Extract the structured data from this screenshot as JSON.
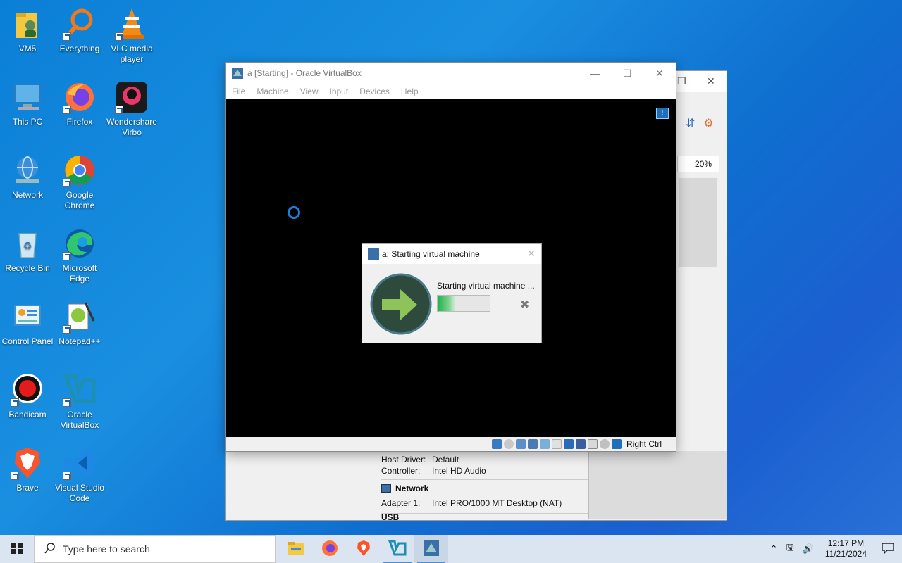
{
  "desktop": {
    "icons": [
      {
        "label": "VM5",
        "icon": "folder-user-icon"
      },
      {
        "label": "Everything",
        "icon": "everything-search-icon"
      },
      {
        "label": "VLC media player",
        "icon": "vlc-cone-icon"
      },
      {
        "label": "This PC",
        "icon": "computer-icon"
      },
      {
        "label": "Firefox",
        "icon": "firefox-icon"
      },
      {
        "label": "Wondershare Virbo",
        "icon": "virbo-icon"
      },
      {
        "label": "Network",
        "icon": "network-globe-icon"
      },
      {
        "label": "Google Chrome",
        "icon": "chrome-icon"
      },
      {
        "label": "Recycle Bin",
        "icon": "recycle-bin-icon"
      },
      {
        "label": "Microsoft Edge",
        "icon": "edge-icon"
      },
      {
        "label": "Control Panel",
        "icon": "control-panel-icon"
      },
      {
        "label": "Notepad++",
        "icon": "notepadpp-icon"
      },
      {
        "label": "Bandicam",
        "icon": "bandicam-icon"
      },
      {
        "label": "Oracle VirtualBox",
        "icon": "virtualbox-icon"
      },
      {
        "label": "Brave",
        "icon": "brave-icon"
      },
      {
        "label": "Visual Studio Code",
        "icon": "vscode-icon"
      }
    ]
  },
  "manager_window": {
    "zoom_value": "20%",
    "audio": {
      "host_driver_label": "Host Driver:",
      "host_driver_value": "Default",
      "controller_label": "Controller:",
      "controller_value": "Intel HD Audio"
    },
    "network": {
      "section_title": "Network",
      "adapter_label": "Adapter 1:",
      "adapter_value": "Intel PRO/1000 MT Desktop (NAT)"
    },
    "next_section_partial": "USB"
  },
  "vm_window": {
    "title": "a [Starting] - Oracle VirtualBox",
    "menu": [
      "File",
      "Machine",
      "View",
      "Input",
      "Devices",
      "Help"
    ],
    "host_key": "Right Ctrl"
  },
  "progress_dialog": {
    "title": "a: Starting virtual machine",
    "message": "Starting virtual machine ...",
    "progress_fraction": 0.35
  },
  "taskbar": {
    "search_placeholder": "Type here to search",
    "apps": [
      "file-explorer-icon",
      "firefox-icon",
      "brave-icon",
      "virtualbox-icon",
      "virtualbox-vm-icon"
    ],
    "time": "12:17 PM",
    "date": "11/21/2024"
  },
  "colors": {
    "desktop_blue": "#0a7fd6",
    "taskbar": "#dbe5f1",
    "progress_green": "#1db34a"
  }
}
